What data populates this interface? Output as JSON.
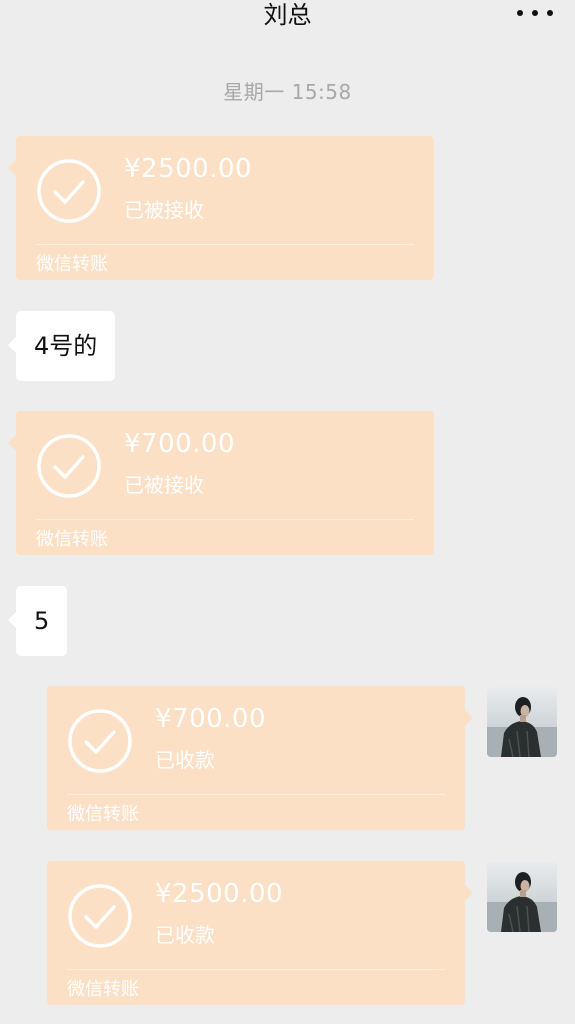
{
  "header": {
    "title": "刘总",
    "more_icon": "more-dots-icon"
  },
  "timestamp": "星期一 15:58",
  "messages": [
    {
      "type": "transfer",
      "side": "left",
      "amount": "¥2500.00",
      "status": "已被接收",
      "label": "微信转账"
    },
    {
      "type": "text",
      "side": "left",
      "text": "4号的"
    },
    {
      "type": "transfer",
      "side": "left",
      "amount": "¥700.00",
      "status": "已被接收",
      "label": "微信转账"
    },
    {
      "type": "text",
      "side": "left",
      "text": "5"
    },
    {
      "type": "transfer",
      "side": "right",
      "amount": "¥700.00",
      "status": "已收款",
      "label": "微信转账"
    },
    {
      "type": "transfer",
      "side": "right",
      "amount": "¥2500.00",
      "status": "已收款",
      "label": "微信转账"
    }
  ],
  "colors": {
    "background": "#ededed",
    "transfer_card": "#fbe0c6",
    "timestamp_text": "#a8a8a8"
  }
}
